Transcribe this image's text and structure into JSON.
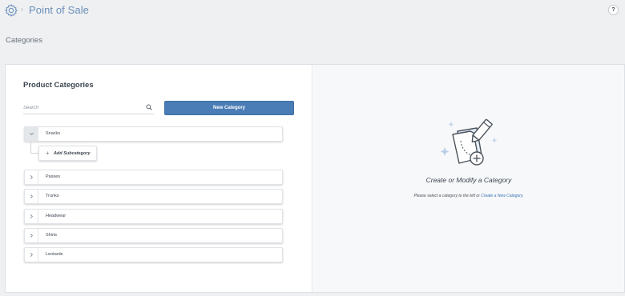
{
  "app": {
    "title": "Point of Sale",
    "separator": "›",
    "icon": "gear-icon",
    "help_label": "?"
  },
  "page": {
    "section_title": "Categories"
  },
  "left": {
    "title": "Product Categories",
    "search": {
      "placeholder": "Search",
      "value": ""
    },
    "new_category_label": "New Category",
    "categories": [
      {
        "label": "Snacks",
        "expanded": true
      },
      {
        "label": "Passes",
        "expanded": false
      },
      {
        "label": "Trunks",
        "expanded": false
      },
      {
        "label": "Headwear",
        "expanded": false
      },
      {
        "label": "Shirts",
        "expanded": false
      },
      {
        "label": "Leotards",
        "expanded": false
      }
    ],
    "add_subcategory_label": "Add Subcategory"
  },
  "right": {
    "empty_title": "Create or Modify a Category",
    "empty_text_prefix": "Please select a category to the left or",
    "empty_link": "Create a New Category",
    "empty_text_suffix": "."
  },
  "colors": {
    "accent": "#4a7db5",
    "title": "#6b8fb8",
    "link": "#3b73b9",
    "background": "#eef0f2"
  }
}
